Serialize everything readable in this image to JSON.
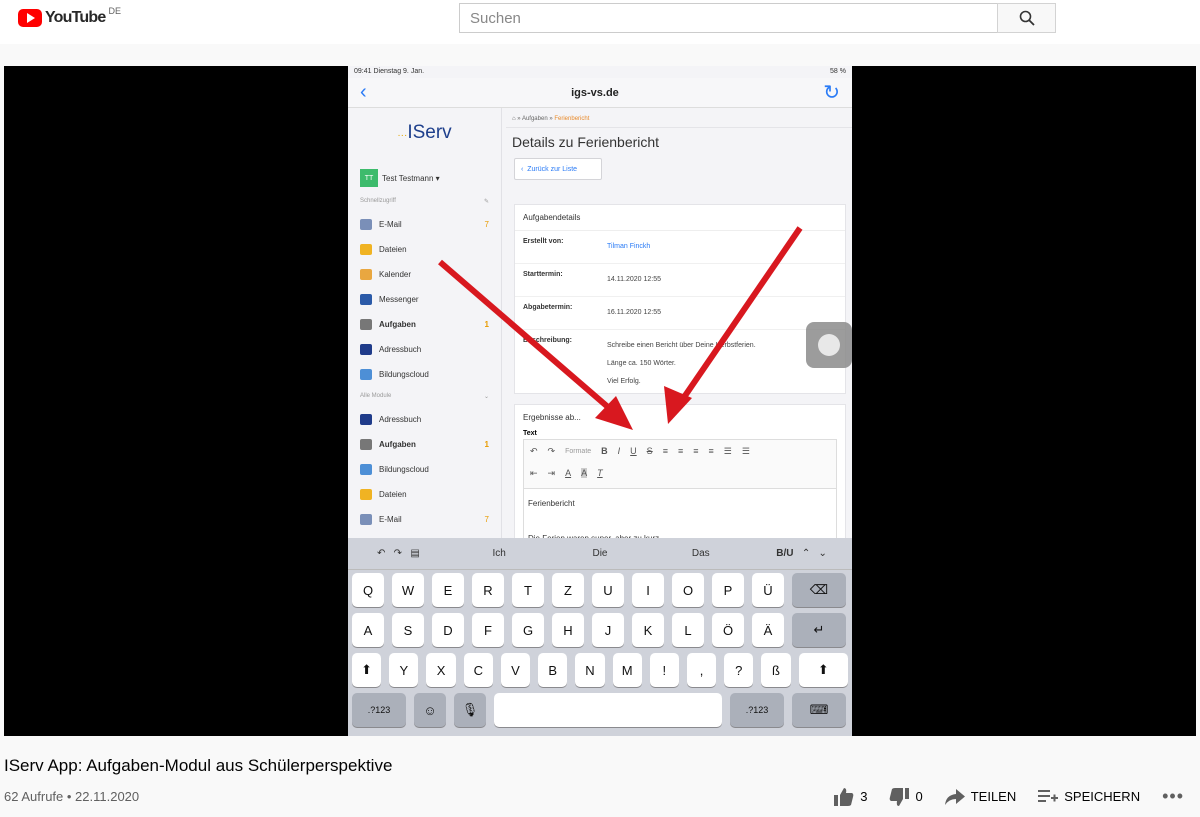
{
  "masthead": {
    "logo_text": "YouTube",
    "country": "DE",
    "search_placeholder": "Suchen"
  },
  "ipad": {
    "status_time": "09:41 Dienstag 9. Jan.",
    "status_battery": "58 %",
    "nav_title": "igs-vs.de",
    "logo": "IServ",
    "user_initials": "TT",
    "user_name": "Test Testmann",
    "quick_access": "Schnellzugriff",
    "quick_items": [
      {
        "label": "E-Mail",
        "badge": "7"
      },
      {
        "label": "Dateien",
        "badge": ""
      },
      {
        "label": "Kalender",
        "badge": ""
      },
      {
        "label": "Messenger",
        "badge": ""
      },
      {
        "label": "Aufgaben",
        "badge": "1"
      },
      {
        "label": "Adressbuch",
        "badge": ""
      },
      {
        "label": "Bildungscloud",
        "badge": ""
      }
    ],
    "all_modules": "Alle Module",
    "module_items": [
      {
        "label": "Adressbuch",
        "badge": ""
      },
      {
        "label": "Aufgaben",
        "badge": "1"
      },
      {
        "label": "Bildungscloud",
        "badge": ""
      },
      {
        "label": "Dateien",
        "badge": ""
      },
      {
        "label": "E-Mail",
        "badge": "7"
      }
    ],
    "crumb_1": "Aufgaben",
    "crumb_2": "Ferienbericht",
    "page_title": "Details zu Ferienbericht",
    "back_button": "Zurück zur Liste",
    "details_header": "Aufgabendetails",
    "created_by_label": "Erstellt von:",
    "created_by_value": "Tilman Finckh",
    "start_label": "Starttermin:",
    "start_value": "14.11.2020 12:55",
    "due_label": "Abgabetermin:",
    "due_value": "16.11.2020 12:55",
    "desc_label": "Beschreibung:",
    "desc_line1": "Schreibe einen Bericht über Deine Herbstferien.",
    "desc_line2": "Länge ca. 150 Wörter.",
    "desc_line3": "Viel Erfolg.",
    "results_header": "Ergebnisse ab...",
    "text_label": "Text",
    "formats_label": "Formate",
    "editor_line1": "Ferienbericht",
    "editor_line2": "Die Ferien waren super, aber zu kurz.",
    "suggestions": [
      "Ich",
      "Die",
      "Das"
    ],
    "biu": "B/U",
    "row1": [
      "Q",
      "W",
      "E",
      "R",
      "T",
      "Z",
      "U",
      "I",
      "O",
      "P",
      "Ü"
    ],
    "row2": [
      "A",
      "S",
      "D",
      "F",
      "G",
      "H",
      "J",
      "K",
      "L",
      "Ö",
      "Ä"
    ],
    "row3": [
      "Y",
      "X",
      "C",
      "V",
      "B",
      "N",
      "M",
      "!",
      ",",
      "?",
      "ß"
    ],
    "num_key": ".?123"
  },
  "video": {
    "title": "IServ App: Aufgaben-Modul aus Schülerperspektive",
    "views": "62 Aufrufe • 22.11.2020",
    "likes": "3",
    "dislikes": "0",
    "share_label": "TEILEN",
    "save_label": "SPEICHERN"
  },
  "colors": {
    "brand_red": "#ff0000",
    "arrow_red": "#d8181f",
    "ios_blue": "#2a7bf6"
  }
}
